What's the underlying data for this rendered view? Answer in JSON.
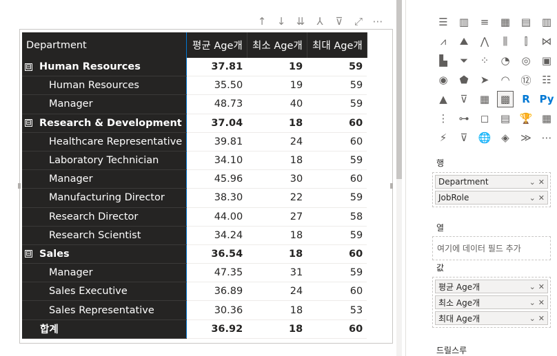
{
  "toolbar": {
    "icons": [
      "arrow-up-icon",
      "arrow-down-icon",
      "double-arrow-down-icon",
      "expand-hierarchy-icon",
      "filter-icon",
      "focus-mode-icon",
      "more-options-icon"
    ],
    "glyphs": [
      "↑",
      "↓",
      "⇊",
      "⅄",
      "⊽",
      "⤢",
      "⋯"
    ]
  },
  "matrix": {
    "headers": [
      "Department",
      "평균 Age개",
      "최소 Age개",
      "최대 Age개"
    ],
    "rows": [
      {
        "type": "group",
        "label": "Human Resources",
        "avg": "37.81",
        "min": "19",
        "max": "59"
      },
      {
        "type": "child",
        "label": "Human Resources",
        "avg": "35.50",
        "min": "19",
        "max": "59"
      },
      {
        "type": "child",
        "label": "Manager",
        "avg": "48.73",
        "min": "40",
        "max": "59"
      },
      {
        "type": "group",
        "label": "Research & Development",
        "avg": "37.04",
        "min": "18",
        "max": "60"
      },
      {
        "type": "child",
        "label": "Healthcare Representative",
        "avg": "39.81",
        "min": "24",
        "max": "60"
      },
      {
        "type": "child",
        "label": "Laboratory Technician",
        "avg": "34.10",
        "min": "18",
        "max": "59"
      },
      {
        "type": "child",
        "label": "Manager",
        "avg": "45.96",
        "min": "30",
        "max": "60"
      },
      {
        "type": "child",
        "label": "Manufacturing Director",
        "avg": "38.30",
        "min": "22",
        "max": "59"
      },
      {
        "type": "child",
        "label": "Research Director",
        "avg": "44.00",
        "min": "27",
        "max": "58"
      },
      {
        "type": "child",
        "label": "Research Scientist",
        "avg": "34.24",
        "min": "18",
        "max": "59"
      },
      {
        "type": "group",
        "label": "Sales",
        "avg": "36.54",
        "min": "18",
        "max": "60"
      },
      {
        "type": "child",
        "label": "Manager",
        "avg": "47.35",
        "min": "31",
        "max": "59"
      },
      {
        "type": "child",
        "label": "Sales Executive",
        "avg": "36.89",
        "min": "24",
        "max": "60"
      },
      {
        "type": "child",
        "label": "Sales Representative",
        "avg": "30.36",
        "min": "18",
        "max": "53"
      }
    ],
    "total": {
      "label": "합계",
      "avg": "36.92",
      "min": "18",
      "max": "60"
    },
    "collapse_glyph": "⊟"
  },
  "pane": {
    "viz_icons": [
      {
        "name": "stacked-bar-icon",
        "glyph": "☰"
      },
      {
        "name": "stacked-column-icon",
        "glyph": "▥"
      },
      {
        "name": "clustered-bar-icon",
        "glyph": "≡"
      },
      {
        "name": "clustered-column-icon",
        "glyph": "▦"
      },
      {
        "name": "100-bar-icon",
        "glyph": "▤"
      },
      {
        "name": "100-column-icon",
        "glyph": "▥"
      },
      {
        "name": "line-chart-icon",
        "glyph": "⩘"
      },
      {
        "name": "area-chart-icon",
        "glyph": "⛰"
      },
      {
        "name": "stacked-area-icon",
        "glyph": "⋀"
      },
      {
        "name": "line-column-icon",
        "glyph": "⫼"
      },
      {
        "name": "line-stacked-column-icon",
        "glyph": "⫿"
      },
      {
        "name": "ribbon-chart-icon",
        "glyph": "⋈"
      },
      {
        "name": "waterfall-icon",
        "glyph": "▙"
      },
      {
        "name": "funnel-icon",
        "glyph": "⏷"
      },
      {
        "name": "scatter-icon",
        "glyph": "⁘"
      },
      {
        "name": "pie-chart-icon",
        "glyph": "◔"
      },
      {
        "name": "donut-chart-icon",
        "glyph": "◎"
      },
      {
        "name": "treemap-icon",
        "glyph": "▣"
      },
      {
        "name": "map-icon",
        "glyph": "◉"
      },
      {
        "name": "filled-map-icon",
        "glyph": "⬟"
      },
      {
        "name": "azure-map-icon",
        "glyph": "➤"
      },
      {
        "name": "gauge-icon",
        "glyph": "◠"
      },
      {
        "name": "card-icon",
        "glyph": "⑫"
      },
      {
        "name": "multi-row-card-icon",
        "glyph": "☷"
      },
      {
        "name": "kpi-icon",
        "glyph": "▲"
      },
      {
        "name": "slicer-icon",
        "glyph": "⊽"
      },
      {
        "name": "table-icon",
        "glyph": "▦"
      },
      {
        "name": "matrix-icon",
        "glyph": "▩"
      },
      {
        "name": "r-visual-icon",
        "glyph": "R"
      },
      {
        "name": "python-visual-icon",
        "glyph": "Py"
      },
      {
        "name": "key-influencers-icon",
        "glyph": "⋮"
      },
      {
        "name": "decomposition-tree-icon",
        "glyph": "⊶"
      },
      {
        "name": "qa-icon",
        "glyph": "◻"
      },
      {
        "name": "narrative-icon",
        "glyph": "▤"
      },
      {
        "name": "trophy-icon",
        "glyph": "🏆"
      },
      {
        "name": "paginated-icon",
        "glyph": "▦"
      },
      {
        "name": "power-apps-icon",
        "glyph": "⚡"
      },
      {
        "name": "power-automate-icon",
        "glyph": "⊽"
      },
      {
        "name": "arcgis-icon",
        "glyph": "🌐"
      },
      {
        "name": "power-apps-logo-icon",
        "glyph": "◈"
      },
      {
        "name": "power-automate-logo-icon",
        "glyph": "≫"
      },
      {
        "name": "more-visuals-icon",
        "glyph": "⋯"
      }
    ],
    "rows_label": "행",
    "rows_fields": [
      "Department",
      "JobRole"
    ],
    "columns_label": "열",
    "columns_placeholder": "여기에 데이터 필드 추가",
    "values_label": "값",
    "values_fields": [
      "평균 Age개",
      "최소 Age개",
      "최대 Age개"
    ],
    "drillthrough_label": "드릴스루"
  }
}
